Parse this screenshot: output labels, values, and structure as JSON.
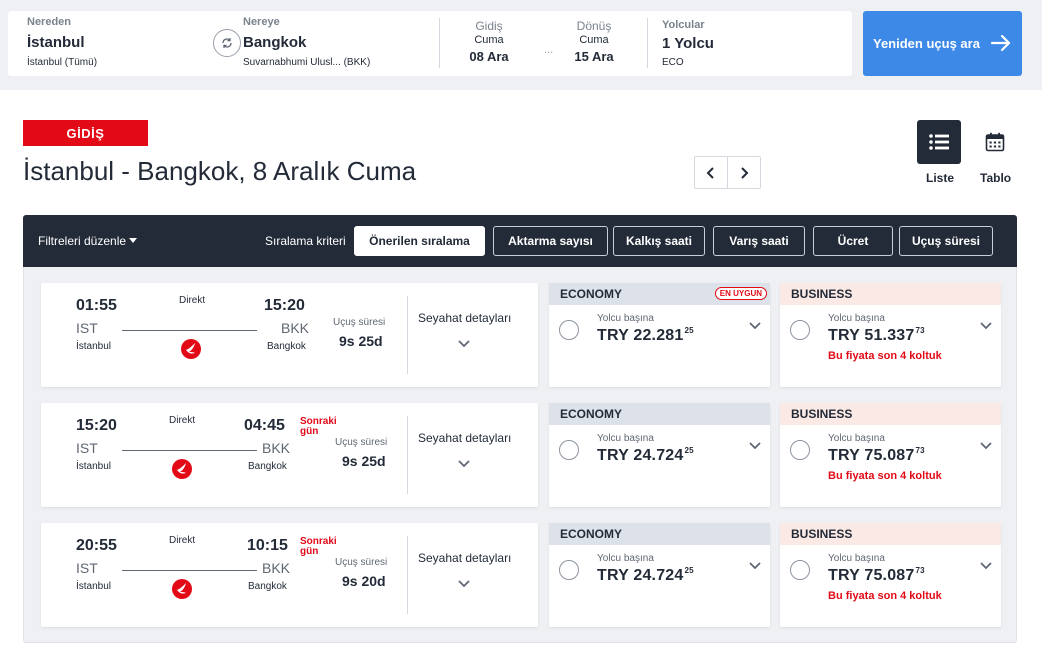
{
  "search": {
    "from_label": "Nereden",
    "from_city": "İstanbul",
    "from_sub": "İstanbul (Tümü)",
    "to_label": "Nereye",
    "to_city": "Bangkok",
    "to_sub": "Suvarnabhumi Ulusl... (BKK)",
    "depart_label": "Gidiş",
    "depart_day": "Cuma",
    "depart_date": "08  Ara",
    "dots": "...",
    "return_label": "Dönüş",
    "return_day": "Cuma",
    "return_date": "15  Ara",
    "pax_label": "Yolcular",
    "pax_value": "1 Yolcu",
    "cabin": "ECO",
    "button_label": "Yeniden uçuş ara"
  },
  "header": {
    "direction_tag": "GİDİŞ",
    "route_title": "İstanbul - Bangkok, 8 Aralık Cuma",
    "view_list_label": "Liste",
    "view_table_label": "Tablo"
  },
  "filters": {
    "edit_label": "Filtreleri düzenle",
    "sort_label": "Sıralama kriteri",
    "sort_options": [
      "Önerilen sıralama",
      "Aktarma sayısı",
      "Kalkış saati",
      "Varış saati",
      "Ücret",
      "Uçuş süresi"
    ],
    "active_sort": "Önerilen sıralama"
  },
  "flights": [
    {
      "dep_time": "01:55",
      "dep_code": "IST",
      "dep_city": "İstanbul",
      "arr_time": "15:20",
      "arr_code": "BKK",
      "arr_city": "Bangkok",
      "stops": "Direkt",
      "next_day": "",
      "duration_label": "Uçuş süresi",
      "duration": "9s 25d",
      "details_label": "Seyahat detayları",
      "economy": {
        "class": "ECONOMY",
        "badge": "EN UYGUN",
        "per_pax": "Yolcu başına",
        "price": "TRY 22.281",
        "cents": "25"
      },
      "business": {
        "class": "BUSINESS",
        "per_pax": "Yolcu başına",
        "price": "TRY 51.337",
        "cents": "73",
        "warning": "Bu fiyata son 4 koltuk"
      }
    },
    {
      "dep_time": "15:20",
      "dep_code": "IST",
      "dep_city": "İstanbul",
      "arr_time": "04:45",
      "arr_code": "BKK",
      "arr_city": "Bangkok",
      "stops": "Direkt",
      "next_day": "Sonraki\ngün",
      "duration_label": "Uçuş süresi",
      "duration": "9s 25d",
      "details_label": "Seyahat detayları",
      "economy": {
        "class": "ECONOMY",
        "badge": "",
        "per_pax": "Yolcu başına",
        "price": "TRY 24.724",
        "cents": "25"
      },
      "business": {
        "class": "BUSINESS",
        "per_pax": "Yolcu başına",
        "price": "TRY 75.087",
        "cents": "73",
        "warning": "Bu fiyata son 4 koltuk"
      }
    },
    {
      "dep_time": "20:55",
      "dep_code": "IST",
      "dep_city": "İstanbul",
      "arr_time": "10:15",
      "arr_code": "BKK",
      "arr_city": "Bangkok",
      "stops": "Direkt",
      "next_day": "Sonraki\ngün",
      "duration_label": "Uçuş süresi",
      "duration": "9s 20d",
      "details_label": "Seyahat detayları",
      "economy": {
        "class": "ECONOMY",
        "badge": "",
        "per_pax": "Yolcu başına",
        "price": "TRY 24.724",
        "cents": "25"
      },
      "business": {
        "class": "BUSINESS",
        "per_pax": "Yolcu başına",
        "price": "TRY 75.087",
        "cents": "73",
        "warning": "Bu fiyata son 4 koltuk"
      }
    }
  ],
  "colors": {
    "brand_red": "#e30a17",
    "primary_blue": "#3d89e8",
    "dark_navy": "#232b38"
  },
  "icons": [
    "swap-icon",
    "arrow-right-icon",
    "chevron-left-icon",
    "chevron-right-icon",
    "list-icon",
    "calendar-icon",
    "chevron-down-icon",
    "airline-logo-icon"
  ]
}
